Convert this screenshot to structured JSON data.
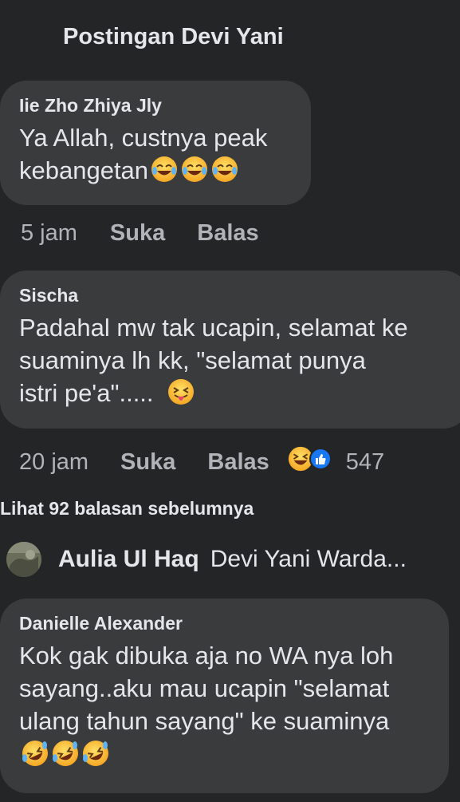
{
  "header": {
    "title": "Postingan Devi Yani"
  },
  "comments": [
    {
      "author": "Iie Zho Zhiya Jly",
      "lines": [
        "Ya Allah, custnya peak",
        "kebangetan"
      ],
      "time": "5 jam",
      "like_label": "Suka",
      "reply_label": "Balas",
      "emojis": [
        "tears-of-joy-emoji",
        "tears-of-joy-emoji",
        "tears-of-joy-emoji"
      ]
    },
    {
      "author": "Sischa",
      "lines": [
        "Padahal mw tak ucapin, selamat ke",
        "suaminya lh kk, \"selamat punya",
        "istri pe'a\"....."
      ],
      "time": "20 jam",
      "like_label": "Suka",
      "reply_label": "Balas",
      "reaction_count": "547",
      "emojis": [
        "tongue-out-emoji"
      ],
      "reaction_icons": [
        "haha-reaction-icon",
        "like-reaction-icon"
      ]
    },
    {
      "author": "Danielle Alexander",
      "lines": [
        "Kok gak dibuka aja no WA nya loh",
        "sayang..aku mau ucapin \"selamat",
        "ulang tahun sayang\" ke suaminya"
      ],
      "emojis": [
        "rolling-laughing-emoji",
        "rolling-laughing-emoji",
        "rolling-laughing-emoji"
      ]
    }
  ],
  "more_replies": "Lihat 92 balasan sebelumnya",
  "reply_preview": {
    "author": "Aulia Ul Haq",
    "text": "Devi Yani Warda..."
  },
  "colors": {
    "background": "#242526",
    "bubble": "#3a3b3c",
    "text": "#e4e6eb",
    "meta": "#b0b3b8",
    "like_blue": "#1877f2"
  }
}
